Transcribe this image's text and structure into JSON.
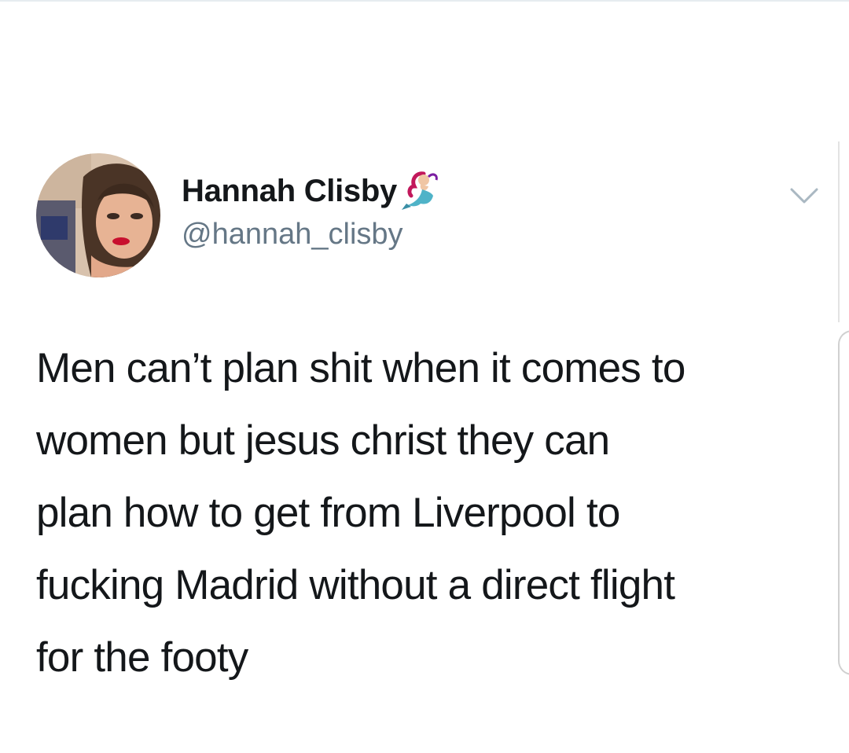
{
  "tweet": {
    "display_name": "Hannah Clisby",
    "handle": "@hannah_clisby",
    "text_lines": [
      "Men can’t plan shit when it comes to",
      "women but jesus christ they can",
      "plan how to get from Liverpool to",
      "fucking Madrid without a direct flight",
      "for the footy"
    ]
  },
  "icons": {
    "badge": "mermaid-emoji-icon",
    "menu": "chevron-down-icon"
  },
  "colors": {
    "name": "#14171a",
    "handle": "#657786",
    "text": "#14171a",
    "chevron": "#aab8c2"
  }
}
